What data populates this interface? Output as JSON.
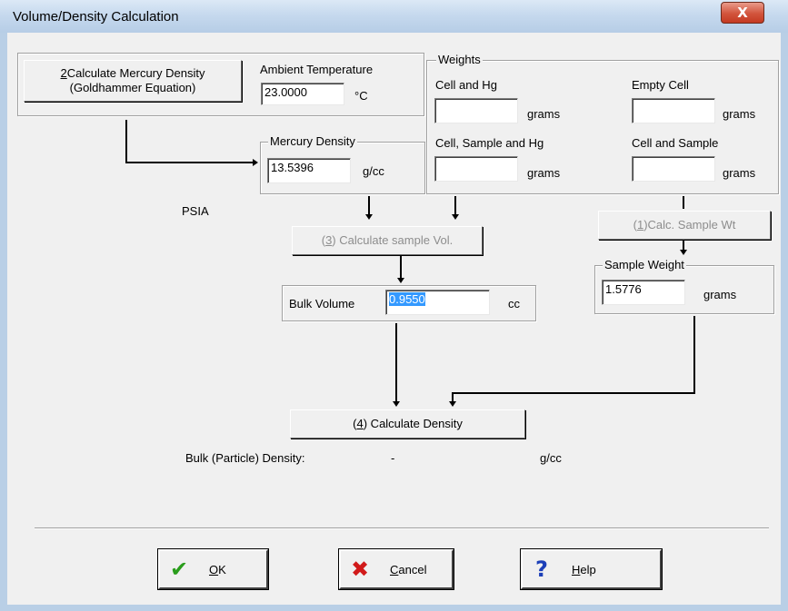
{
  "window": {
    "title": "Volume/Density Calculation",
    "close_label": "X"
  },
  "mercury_density_button": {
    "line1": "(2)Calculate Mercury Density",
    "line2": "(Goldhammer Equation)",
    "mnemonic": "2"
  },
  "ambient_temperature": {
    "label": "Ambient Temperature",
    "value": "23.0000",
    "unit": "°C"
  },
  "mercury_density": {
    "group_title": "Mercury Density",
    "value": "13.5396",
    "unit": "g/cc"
  },
  "weights": {
    "group_title": "Weights",
    "cell_and_hg": {
      "label": "Cell and Hg",
      "value": "",
      "unit": "grams"
    },
    "empty_cell": {
      "label": "Empty Cell",
      "value": "",
      "unit": "grams"
    },
    "cell_sample_hg": {
      "label": "Cell, Sample and Hg",
      "value": "",
      "unit": "grams"
    },
    "cell_and_sample": {
      "label": "Cell and Sample",
      "value": "",
      "unit": "grams"
    }
  },
  "psia_label": "PSIA",
  "calc_sample_weight_button": {
    "label": "(1)Calc. Sample Wt",
    "mnemonic": "1",
    "rest": "Calc. Sample Wt"
  },
  "calc_sample_volume_button": {
    "label": "(3) Calculate sample Vol.",
    "mnemonic": "3",
    "rest": " Calculate sample Vol."
  },
  "sample_weight": {
    "group_title": "Sample Weight",
    "value": "1.5776",
    "unit": "grams"
  },
  "bulk_volume": {
    "label": "Bulk Volume",
    "value": "0.9550",
    "unit": "cc"
  },
  "calc_density_button": {
    "label": "(4) Calculate Density",
    "mnemonic": "4",
    "rest": " Calculate Density"
  },
  "bulk_density": {
    "label": "Bulk (Particle) Density:",
    "value": "-",
    "unit": "g/cc"
  },
  "buttons": {
    "ok": {
      "label": "OK",
      "mnemonic": "O",
      "rest": "K",
      "icon": "check-icon",
      "color": "#2a9d1c"
    },
    "cancel": {
      "label": "Cancel",
      "mnemonic": "C",
      "rest": "ancel",
      "icon": "x-icon",
      "color": "#d11a1a"
    },
    "help": {
      "label": "Help",
      "mnemonic": "H",
      "rest": "elp",
      "icon": "question-icon",
      "color": "#1c3fb8"
    }
  }
}
